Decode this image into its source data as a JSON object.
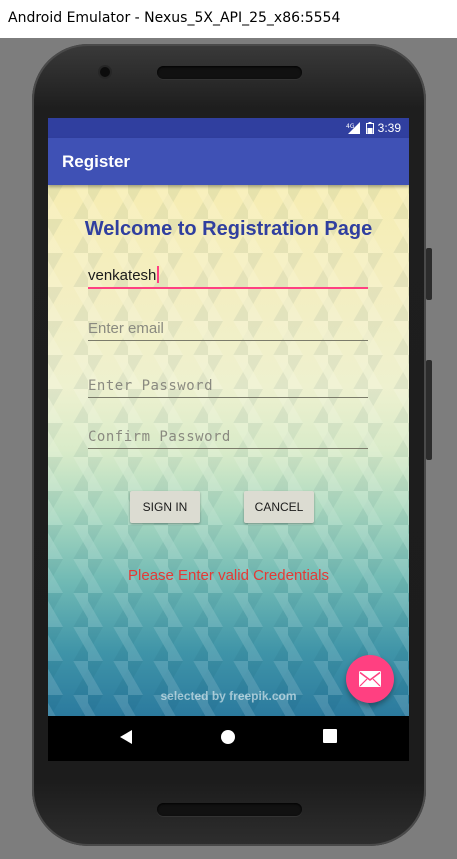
{
  "window": {
    "title": "Android Emulator - Nexus_5X_API_25_x86:5554"
  },
  "status_bar": {
    "network": "4G",
    "time": "3:39"
  },
  "app_bar": {
    "title": "Register"
  },
  "form": {
    "heading": "Welcome to Registration Page",
    "name_value": "venkatesh",
    "email_placeholder": "Enter email",
    "password_placeholder": "Enter Password",
    "confirm_placeholder": "Confirm Password",
    "sign_in_label": "SIGN IN",
    "cancel_label": "CANCEL",
    "error_text": "Please Enter valid Credentials"
  },
  "background_credit": "selected by freepik.com",
  "fab": {
    "icon": "email-icon"
  },
  "nav_bar": {
    "icons": [
      "back-icon",
      "home-icon",
      "recents-icon"
    ]
  },
  "colors": {
    "primary": "#3f51b5",
    "primary_dark": "#303f9f",
    "accent": "#ff4081",
    "error": "#e53935"
  }
}
